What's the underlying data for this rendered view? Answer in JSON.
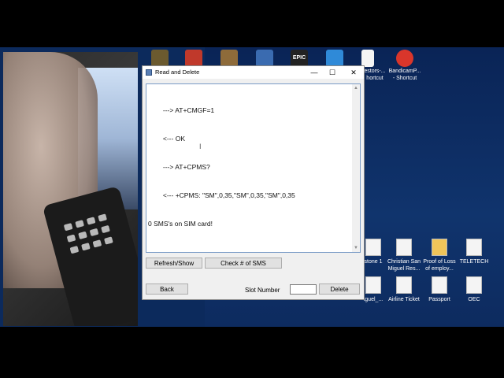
{
  "window": {
    "title": "Read and Delete",
    "minimize_glyph": "—",
    "maximize_glyph": "☐",
    "close_glyph": "✕"
  },
  "log": {
    "lines": [
      "        ---> AT+CMGF=1",
      "        <--- OK",
      "        ---> AT+CPMS?",
      "        <--- +CPMS: \"SM\",0,35,\"SM\",0,35,\"SM\",0,35",
      "0 SMS's on SIM card!"
    ]
  },
  "buttons": {
    "refresh": "Refresh/Show",
    "check": "Check # of SMS",
    "back": "Back",
    "delete": "Delete"
  },
  "slot": {
    "label": "Slot Number",
    "value": ""
  },
  "desktop_icons": [
    {
      "label": "estors-...\nhortcut"
    },
    {
      "label": "BandicamP...\n- Shortcut"
    },
    {
      "label": "stone 1"
    },
    {
      "label": "Christian San\nMiguel Res..."
    },
    {
      "label": "Proof of Loss\nof employ..."
    },
    {
      "label": "TELETECH"
    },
    {
      "label": "iguel_..."
    },
    {
      "label": "Airline Ticket"
    },
    {
      "label": "Passport"
    },
    {
      "label": "OEC"
    }
  ],
  "top_icon_labels": [
    "EPIC"
  ],
  "colors": {
    "desktop": "#0c2a5c",
    "window_bg": "#f0f0f0",
    "log_border": "#7a9cc6"
  }
}
